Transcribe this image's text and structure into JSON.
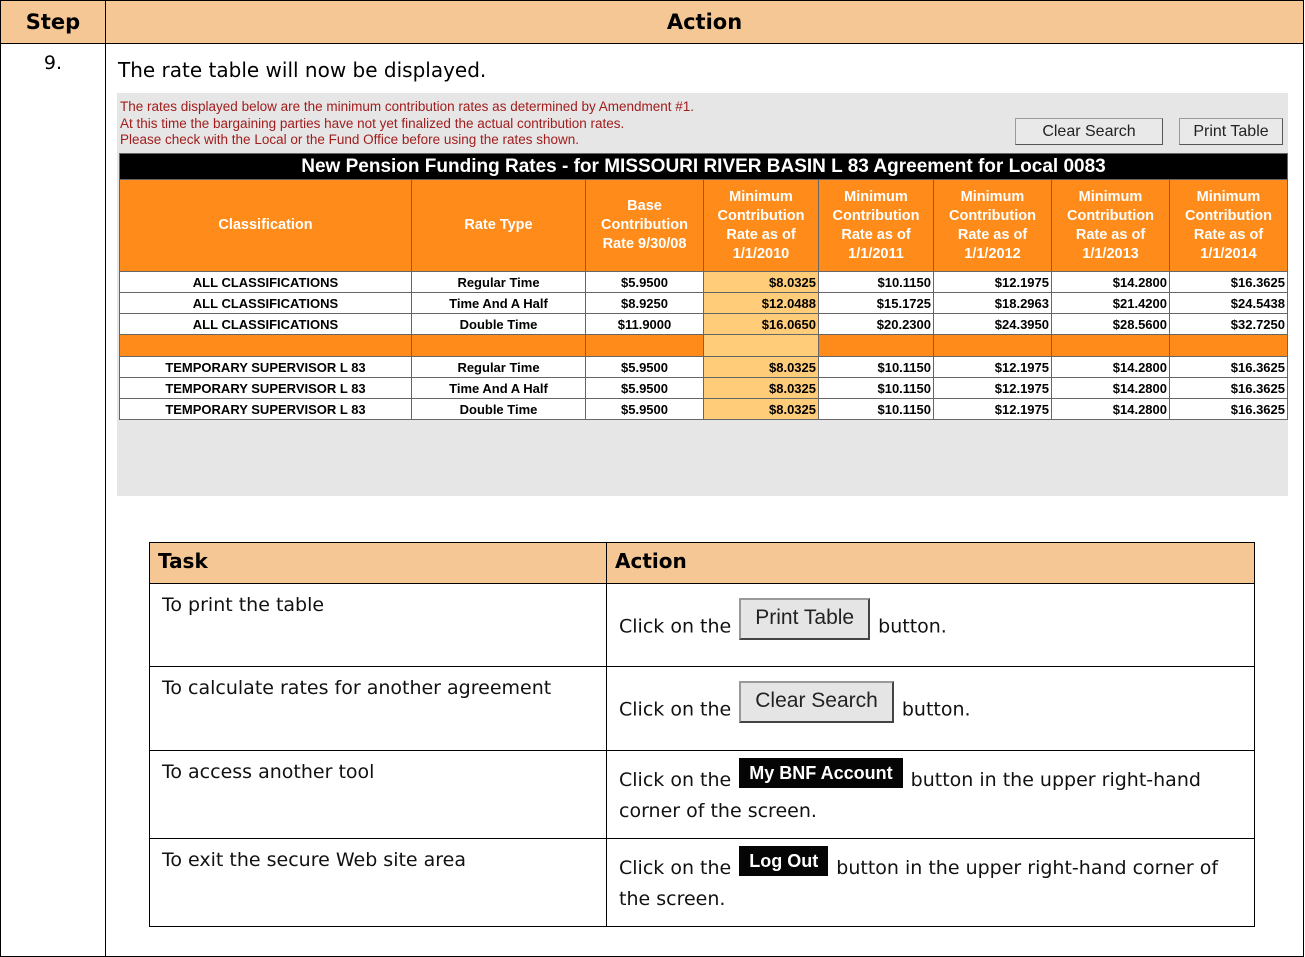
{
  "header": {
    "step": "Step",
    "action": "Action"
  },
  "step_number": "9.",
  "intro": "The rate table will now be displayed.",
  "screenshot": {
    "notes": [
      "The rates displayed below are the minimum contribution rates as determined by Amendment #1.",
      "At this time the bargaining parties have not yet finalized the actual contribution rates.",
      "Please check with the Local or the Fund Office before using the rates shown."
    ],
    "buttons": {
      "clear": "Clear Search",
      "print": "Print Table"
    },
    "table_title": "New Pension Funding Rates - for MISSOURI RIVER BASIN L 83 Agreement for Local 0083",
    "columns": [
      "Classification",
      "Rate Type",
      "Base Contribution Rate 9/30/08",
      "Minimum Contribution Rate as of 1/1/2010",
      "Minimum Contribution Rate as of 1/1/2011",
      "Minimum Contribution Rate as of 1/1/2012",
      "Minimum Contribution Rate as of 1/1/2013",
      "Minimum Contribution Rate as of 1/1/2014"
    ],
    "rows": [
      [
        "ALL CLASSIFICATIONS",
        "Regular Time",
        "$5.9500",
        "$8.0325",
        "$10.1150",
        "$12.1975",
        "$14.2800",
        "$16.3625"
      ],
      [
        "ALL CLASSIFICATIONS",
        "Time And A Half",
        "$8.9250",
        "$12.0488",
        "$15.1725",
        "$18.2963",
        "$21.4200",
        "$24.5438"
      ],
      [
        "ALL CLASSIFICATIONS",
        "Double Time",
        "$11.9000",
        "$16.0650",
        "$20.2300",
        "$24.3950",
        "$28.5600",
        "$32.7250"
      ],
      [
        "",
        "",
        "",
        "",
        "",
        "",
        "",
        ""
      ],
      [
        "TEMPORARY SUPERVISOR L 83",
        "Regular Time",
        "$5.9500",
        "$8.0325",
        "$10.1150",
        "$12.1975",
        "$14.2800",
        "$16.3625"
      ],
      [
        "TEMPORARY SUPERVISOR L 83",
        "Time And A Half",
        "$5.9500",
        "$8.0325",
        "$10.1150",
        "$12.1975",
        "$14.2800",
        "$16.3625"
      ],
      [
        "TEMPORARY SUPERVISOR L 83",
        "Double Time",
        "$5.9500",
        "$8.0325",
        "$10.1150",
        "$12.1975",
        "$14.2800",
        "$16.3625"
      ]
    ]
  },
  "tasks": {
    "header": {
      "task": "Task",
      "action": "Action"
    },
    "rows": [
      {
        "task": "To print the table",
        "pre": "Click on the",
        "button": "Print Table",
        "post": "button."
      },
      {
        "task": "To calculate rates for another agreement",
        "pre": "Click on the",
        "button": "Clear Search",
        "post": "button."
      },
      {
        "task": "To access another tool",
        "pre": "Click on the",
        "button": "My BNF Account",
        "post": "button in the upper right-hand corner of the screen."
      },
      {
        "task": "To exit the secure Web site area",
        "pre": "Click on the",
        "button": "Log Out",
        "post": "button in the upper right-hand corner of the screen."
      }
    ]
  }
}
